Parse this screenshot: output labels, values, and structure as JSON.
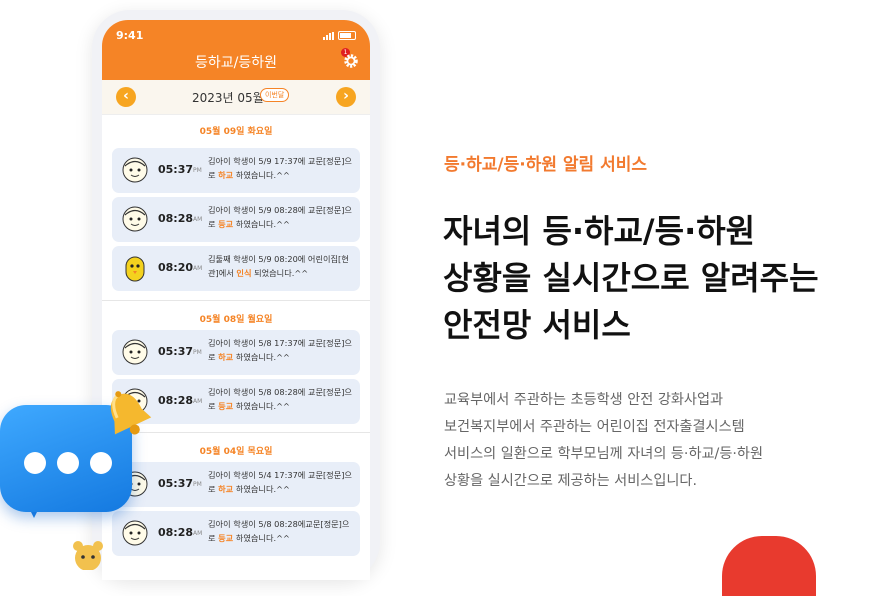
{
  "phone": {
    "status_time": "9:41",
    "app_title": "등하교/등하원",
    "settings_badge": "1",
    "month_label": "2023년 05월",
    "this_month_chip": "이번달",
    "prev_icon": "chevron-left-icon",
    "next_icon": "chevron-right-icon",
    "groups": [
      {
        "date": "05월 09일 화요일",
        "items": [
          {
            "time": "05:37",
            "ampm": "PM",
            "avatar": "child-face-icon",
            "pre": "김아이 학생이 5/9 17:37에 교문[정문]으로 ",
            "hl": "하교",
            "post": " 하였습니다.^^"
          },
          {
            "time": "08:28",
            "ampm": "AM",
            "avatar": "child-face-icon",
            "pre": "김아이 학생이 5/9 08:28에 교문[정문]으로 ",
            "hl": "등교",
            "post": " 하였습니다.^^"
          },
          {
            "time": "08:20",
            "ampm": "AM",
            "avatar": "yellow-chick-icon",
            "pre": "김둘째 학생이 5/9 08:20에 어린이집[현관]에서 ",
            "hl": "인식",
            "post": " 되었습니다.^^"
          }
        ]
      },
      {
        "date": "05월 08일 월요일",
        "items": [
          {
            "time": "05:37",
            "ampm": "PM",
            "avatar": "child-face-icon",
            "pre": "김아이 학생이 5/8 17:37에 교문[정문]으로 ",
            "hl": "하교",
            "post": " 하였습니다.^^"
          },
          {
            "time": "08:28",
            "ampm": "AM",
            "avatar": "child-face-icon",
            "pre": "김아이 학생이 5/8 08:28에 교문[정문]으로 ",
            "hl": "등교",
            "post": " 하였습니다.^^"
          }
        ]
      },
      {
        "date": "05월 04일 목요일",
        "items": [
          {
            "time": "05:37",
            "ampm": "PM",
            "avatar": "child-face-icon",
            "pre": "김아이 학생이 5/4 17:37에 교문[정문]으로 ",
            "hl": "하교",
            "post": " 하였습니다.^^"
          },
          {
            "time": "08:28",
            "ampm": "AM",
            "avatar": "child-face-icon",
            "pre": "김아이 학생이 5/8 08:28에교문[정문]으로 ",
            "hl": "등교",
            "post": " 하였습니다.^^"
          }
        ]
      }
    ]
  },
  "content": {
    "eyebrow": "등·하교/등·하원 알림 서비스",
    "headline_lines": [
      "자녀의 등·하교/등·하원",
      "상황을 실시간으로 알려주는",
      "안전망 서비스"
    ],
    "desc_lines": [
      "교육부에서 주관하는 초등학생 안전 강화사업과",
      "보건복지부에서 주관하는 어린이집 전자출결시스템",
      "서비스의 일환으로 학부모님께 자녀의 등·하교/등·하원",
      "상황을 실시간으로 제공하는 서비스입니다."
    ]
  },
  "decor": {
    "bubble_icon": "chat-bubble-icon",
    "bell_icon": "bell-icon",
    "brand_orange": "#f58426",
    "accent_blue": "#1479e0"
  }
}
